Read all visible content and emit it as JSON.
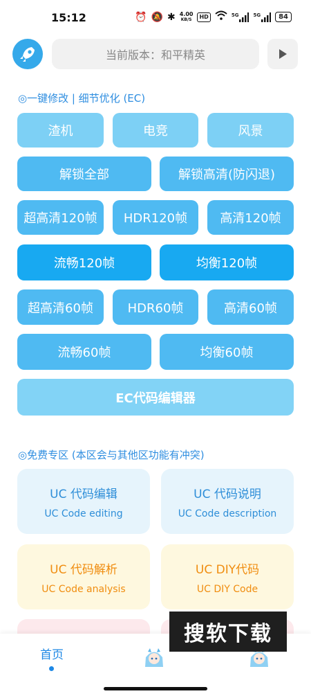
{
  "status": {
    "time": "15:12",
    "net_speed_top": "4.00",
    "net_speed_unit": "KB/S",
    "hd_label": "HD",
    "sim1_label": "5G",
    "sim2_label": "5G",
    "battery": "84"
  },
  "header": {
    "version_text": "当前版本：和平精英"
  },
  "section1": {
    "title": "◎一键修改 | 细节优化 (EC)",
    "buttons": {
      "zhaji": "渣机",
      "dianjing": "电竞",
      "fengjing": "风景",
      "unlock_all": "解锁全部",
      "unlock_hd": "解锁高清(防闪退)",
      "uhd120": "超高清120帧",
      "hdr120": "HDR120帧",
      "hd120": "高清120帧",
      "smooth120": "流畅120帧",
      "balanced120": "均衡120帧",
      "uhd60": "超高清60帧",
      "hdr60": "HDR60帧",
      "hd60": "高清60帧",
      "smooth60": "流畅60帧",
      "balanced60": "均衡60帧",
      "ec_editor": "EC代码编辑器"
    }
  },
  "section2": {
    "title": "◎免费专区 (本区会与其他区功能有冲突)",
    "cards": {
      "uc_edit": {
        "title": "UC 代码编辑",
        "subtitle": "UC Code editing"
      },
      "uc_desc": {
        "title": "UC 代码说明",
        "subtitle": "UC Code description"
      },
      "uc_analysis": {
        "title": "UC 代码解析",
        "subtitle": "UC Code analysis"
      },
      "uc_diy": {
        "title": "UC DIY代码",
        "subtitle": "UC DIY Code"
      }
    }
  },
  "watermark": "搜软下载",
  "nav": {
    "home": "首页"
  },
  "colors": {
    "accent": "#1e88e5",
    "button_light": "#7dd0f5",
    "button_mid": "#4fbaf2",
    "button_dark": "#18a9f1"
  }
}
